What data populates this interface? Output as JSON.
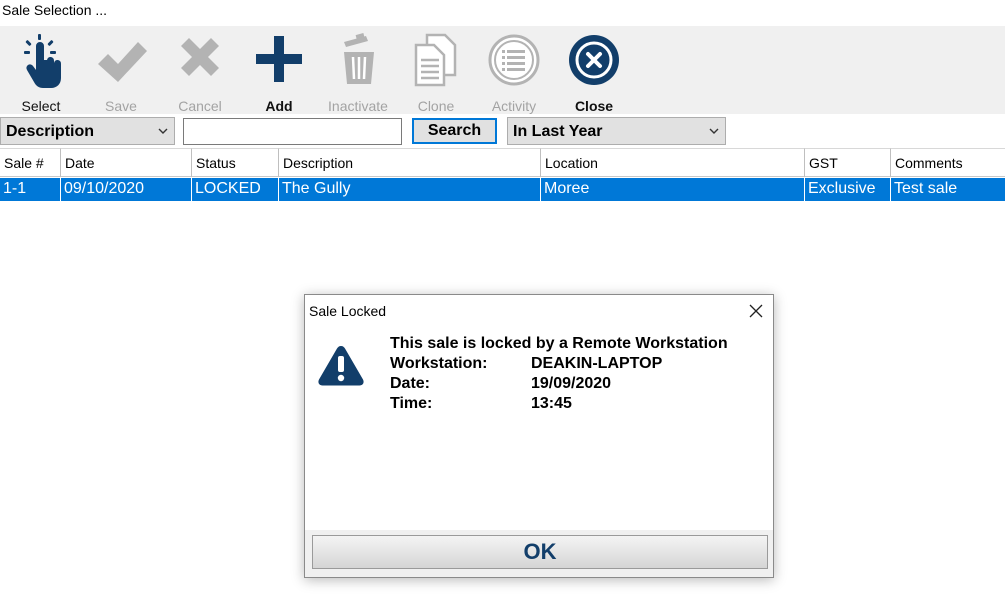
{
  "window": {
    "title": "Sale Selection ..."
  },
  "toolbar": {
    "select": "Select",
    "save": "Save",
    "cancel": "Cancel",
    "add": "Add",
    "inactivate": "Inactivate",
    "clone": "Clone",
    "activity": "Activity",
    "close": "Close"
  },
  "filter": {
    "field": "Description",
    "search_value": "",
    "search_button": "Search",
    "period": "In Last Year"
  },
  "grid": {
    "columns": [
      "Sale #",
      "Date",
      "Status",
      "Description",
      "Location",
      "GST",
      "Comments"
    ],
    "rows": [
      [
        "1-1",
        "09/10/2020",
        "LOCKED",
        "The Gully",
        "Moree",
        "Exclusive",
        "Test sale"
      ]
    ]
  },
  "dialog": {
    "title": "Sale Locked",
    "heading": "This sale is locked by a Remote Workstation",
    "workstation_label": "Workstation:",
    "workstation_value": "DEAKIN-LAPTOP",
    "date_label": "Date:",
    "date_value": "19/09/2020",
    "time_label": "Time:",
    "time_value": "13:45",
    "ok": "OK"
  },
  "colors": {
    "accent": "#0078d7",
    "icon_navy": "#123e6a",
    "disabled_gray": "#b3b3b3"
  },
  "icons": [
    "tap-icon",
    "check-icon",
    "x-icon",
    "plus-icon",
    "trash-icon",
    "document-icon",
    "list-icon",
    "close-circle-icon",
    "chevron-down-icon",
    "warning-icon"
  ]
}
